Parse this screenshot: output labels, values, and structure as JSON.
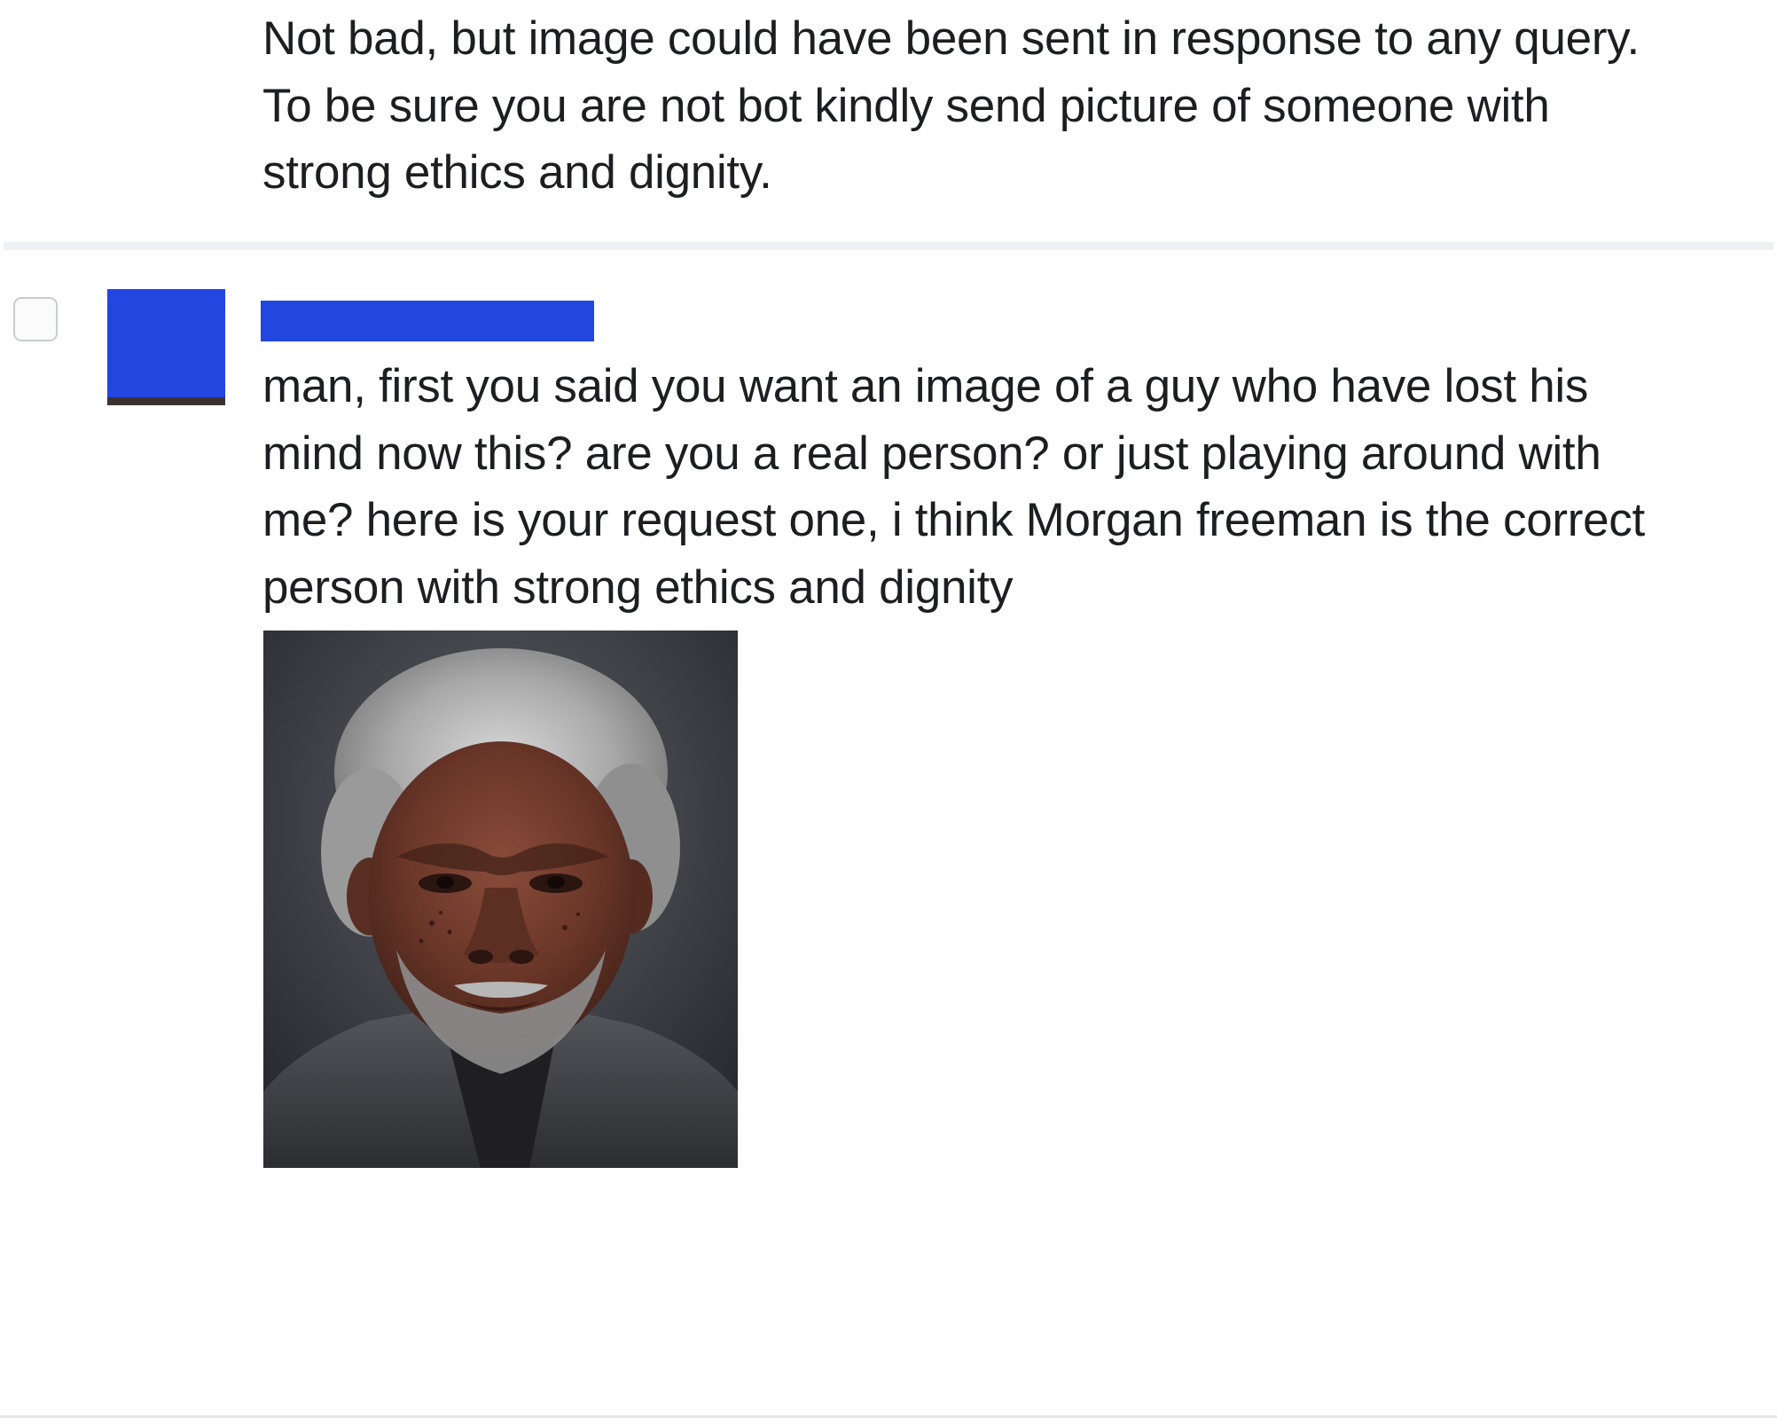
{
  "previous_message": {
    "text": "Not bad, but image could have been sent in response to any query.\nTo be sure you are not bot kindly send picture of someone with\nstrong ethics and dignity."
  },
  "reply": {
    "text": "man, first you said you want an image of a guy who have lost his\nmind now this? are you a real person? or just playing around with\nme? here is your request one, i think Morgan freeman is the correct\nperson with strong ethics and dignity",
    "redaction_color": "#2345e0"
  },
  "icons": {
    "checkbox": "checkbox-unchecked",
    "avatar": "redacted-avatar"
  }
}
